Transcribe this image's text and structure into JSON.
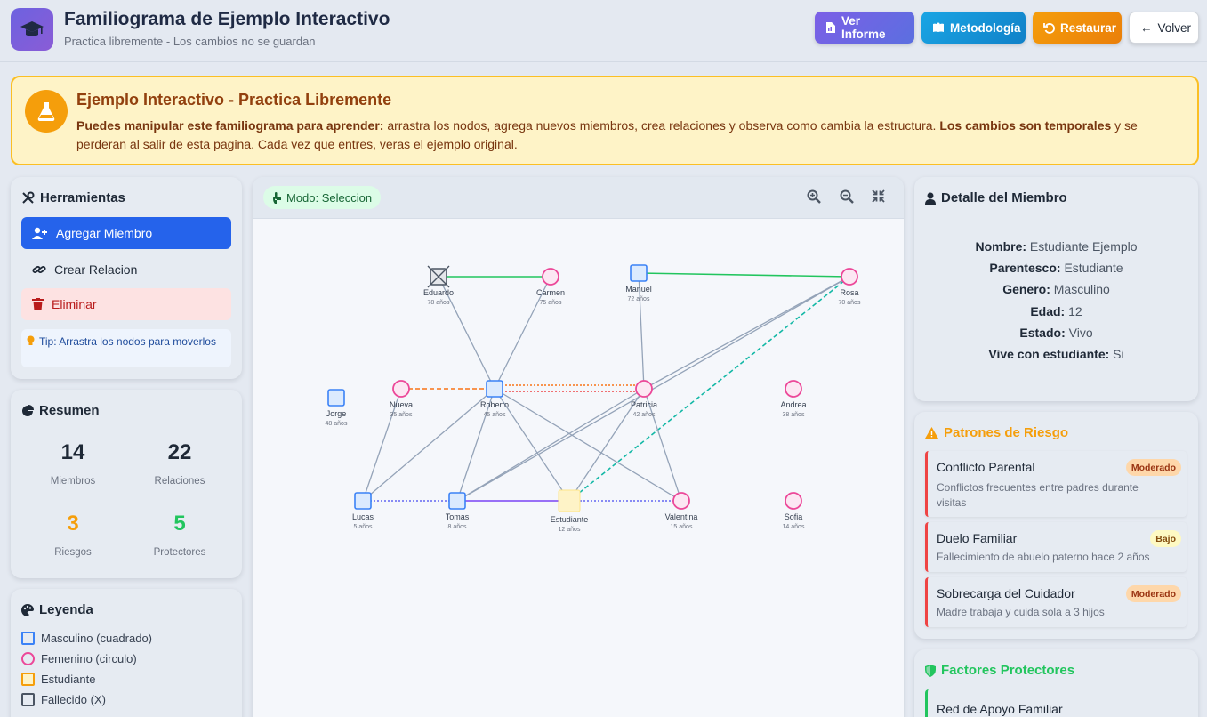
{
  "header": {
    "title": "Familiograma de Ejemplo Interactivo",
    "subtitle": "Practica libremente - Los cambios no se guardan",
    "buttons": {
      "informe": "Ver Informe",
      "metodologia": "Metodología",
      "restaurar": "Restaurar",
      "volver": "Volver"
    }
  },
  "banner": {
    "title": "Ejemplo Interactivo - Practica Libremente",
    "bold1": "Puedes manipular este familiograma para aprender:",
    "text1": " arrastra los nodos, agrega nuevos miembros, crea relaciones y observa como cambia la estructura. ",
    "bold2": "Los cambios son temporales",
    "text2": " y se perderan al salir de esta pagina. Cada vez que entres, veras el ejemplo original."
  },
  "tools": {
    "title": "Herramientas",
    "add": "Agregar Miembro",
    "relation": "Crear Relacion",
    "delete": "Eliminar",
    "tip": "Tip: Arrastra los nodos para moverlos"
  },
  "summary": {
    "title": "Resumen",
    "members": "14",
    "members_label": "Miembros",
    "relations": "22",
    "relations_label": "Relaciones",
    "risks": "3",
    "risks_label": "Riesgos",
    "protectors": "5",
    "protectors_label": "Protectores"
  },
  "legend": {
    "title": "Leyenda",
    "items": [
      "Masculino (cuadrado)",
      "Femenino (circulo)",
      "Estudiante",
      "Fallecido (X)"
    ]
  },
  "canvas": {
    "mode": "Modo: Seleccion",
    "nodes": [
      {
        "id": "eduardo",
        "name": "Eduardo",
        "age": "78 años",
        "gender": "M",
        "deceased": true
      },
      {
        "id": "carmen",
        "name": "Carmen",
        "age": "75 años",
        "gender": "F"
      },
      {
        "id": "manuel",
        "name": "Manuel",
        "age": "72 años",
        "gender": "M"
      },
      {
        "id": "rosa",
        "name": "Rosa",
        "age": "70 años",
        "gender": "F"
      },
      {
        "id": "jorge",
        "name": "Jorge",
        "age": "48 años",
        "gender": "M"
      },
      {
        "id": "nueva",
        "name": "Nueva",
        "age": "35 años",
        "gender": "F"
      },
      {
        "id": "roberto",
        "name": "Roberto",
        "age": "45 años",
        "gender": "M"
      },
      {
        "id": "patricia",
        "name": "Patricia",
        "age": "42 años",
        "gender": "F"
      },
      {
        "id": "andrea",
        "name": "Andrea",
        "age": "38 años",
        "gender": "F"
      },
      {
        "id": "lucas",
        "name": "Lucas",
        "age": "5 años",
        "gender": "M"
      },
      {
        "id": "tomas",
        "name": "Tomas",
        "age": "8 años",
        "gender": "M"
      },
      {
        "id": "estudiante",
        "name": "Estudiante",
        "age": "12 años",
        "gender": "S"
      },
      {
        "id": "valentina",
        "name": "Valentina",
        "age": "15 años",
        "gender": "F"
      },
      {
        "id": "sofia",
        "name": "Sofia",
        "age": "14 años",
        "gender": "F"
      }
    ],
    "edges": [
      {
        "from": "eduardo",
        "to": "carmen",
        "kind": "marriage"
      },
      {
        "from": "manuel",
        "to": "rosa",
        "kind": "marriage"
      },
      {
        "from": "eduardo",
        "to": "roberto",
        "kind": "child"
      },
      {
        "from": "carmen",
        "to": "roberto",
        "kind": "child"
      },
      {
        "from": "manuel",
        "to": "patricia",
        "kind": "child"
      },
      {
        "from": "rosa",
        "to": "patricia",
        "kind": "child"
      },
      {
        "from": "rosa",
        "to": "tomas",
        "kind": "child"
      },
      {
        "from": "rosa",
        "to": "estudiante",
        "kind": "close"
      },
      {
        "from": "nueva",
        "to": "roberto",
        "kind": "partner"
      },
      {
        "from": "roberto",
        "to": "patricia",
        "kind": "conflict-a"
      },
      {
        "from": "roberto",
        "to": "patricia",
        "kind": "conflict-b"
      },
      {
        "from": "nueva",
        "to": "lucas",
        "kind": "child"
      },
      {
        "from": "roberto",
        "to": "lucas",
        "kind": "child"
      },
      {
        "from": "roberto",
        "to": "tomas",
        "kind": "child"
      },
      {
        "from": "roberto",
        "to": "estudiante",
        "kind": "child"
      },
      {
        "from": "roberto",
        "to": "valentina",
        "kind": "child"
      },
      {
        "from": "patricia",
        "to": "tomas",
        "kind": "child"
      },
      {
        "from": "patricia",
        "to": "estudiante",
        "kind": "child"
      },
      {
        "from": "patricia",
        "to": "valentina",
        "kind": "child"
      },
      {
        "from": "lucas",
        "to": "tomas",
        "kind": "distant"
      },
      {
        "from": "tomas",
        "to": "estudiante",
        "kind": "strong"
      },
      {
        "from": "estudiante",
        "to": "valentina",
        "kind": "distant"
      }
    ]
  },
  "detail": {
    "title": "Detalle del Miembro",
    "rows": [
      {
        "label": "Nombre:",
        "value": "Estudiante Ejemplo"
      },
      {
        "label": "Parentesco:",
        "value": "Estudiante"
      },
      {
        "label": "Genero:",
        "value": "Masculino"
      },
      {
        "label": "Edad:",
        "value": "12"
      },
      {
        "label": "Estado:",
        "value": "Vivo"
      },
      {
        "label": "Vive con estudiante:",
        "value": "Si"
      }
    ]
  },
  "risks": {
    "title": "Patrones de Riesgo",
    "items": [
      {
        "title": "Conflicto Parental",
        "level": "Moderado",
        "desc": "Conflictos frecuentes entre padres durante visitas"
      },
      {
        "title": "Duelo Familiar",
        "level": "Bajo",
        "desc": "Fallecimiento de abuelo paterno hace 2 años"
      },
      {
        "title": "Sobrecarga del Cuidador",
        "level": "Moderado",
        "desc": "Madre trabaja y cuida sola a 3 hijos"
      }
    ]
  },
  "protective": {
    "title": "Factores Protectores",
    "items": [
      "Red de Apoyo Familiar"
    ]
  },
  "colors": {
    "male": "#3b82f6",
    "female": "#ec4899",
    "student": "#f59e0b",
    "marriage": "#22c55e",
    "child": "#94a3b8",
    "conflict": "#f97316"
  }
}
